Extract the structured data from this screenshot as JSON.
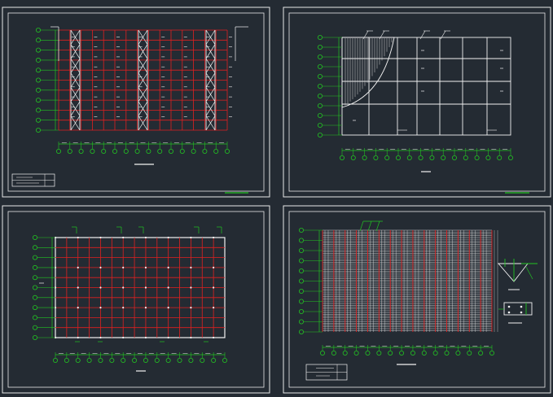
{
  "colors": {
    "background": "#242b33",
    "frame": "#e8e8e8",
    "axis": "#22c422",
    "grid": "#e02020",
    "member": "#f2f2f2",
    "hatch": "#d8d8d8"
  },
  "sheets": [
    {
      "id": "top-left",
      "content": "roof-support-plan"
    },
    {
      "id": "top-right",
      "content": "wall-framing-elevation"
    },
    {
      "id": "bottom-left",
      "content": "anchor-bolt-plan"
    },
    {
      "id": "bottom-right",
      "content": "purlin-plan-with-details"
    }
  ]
}
